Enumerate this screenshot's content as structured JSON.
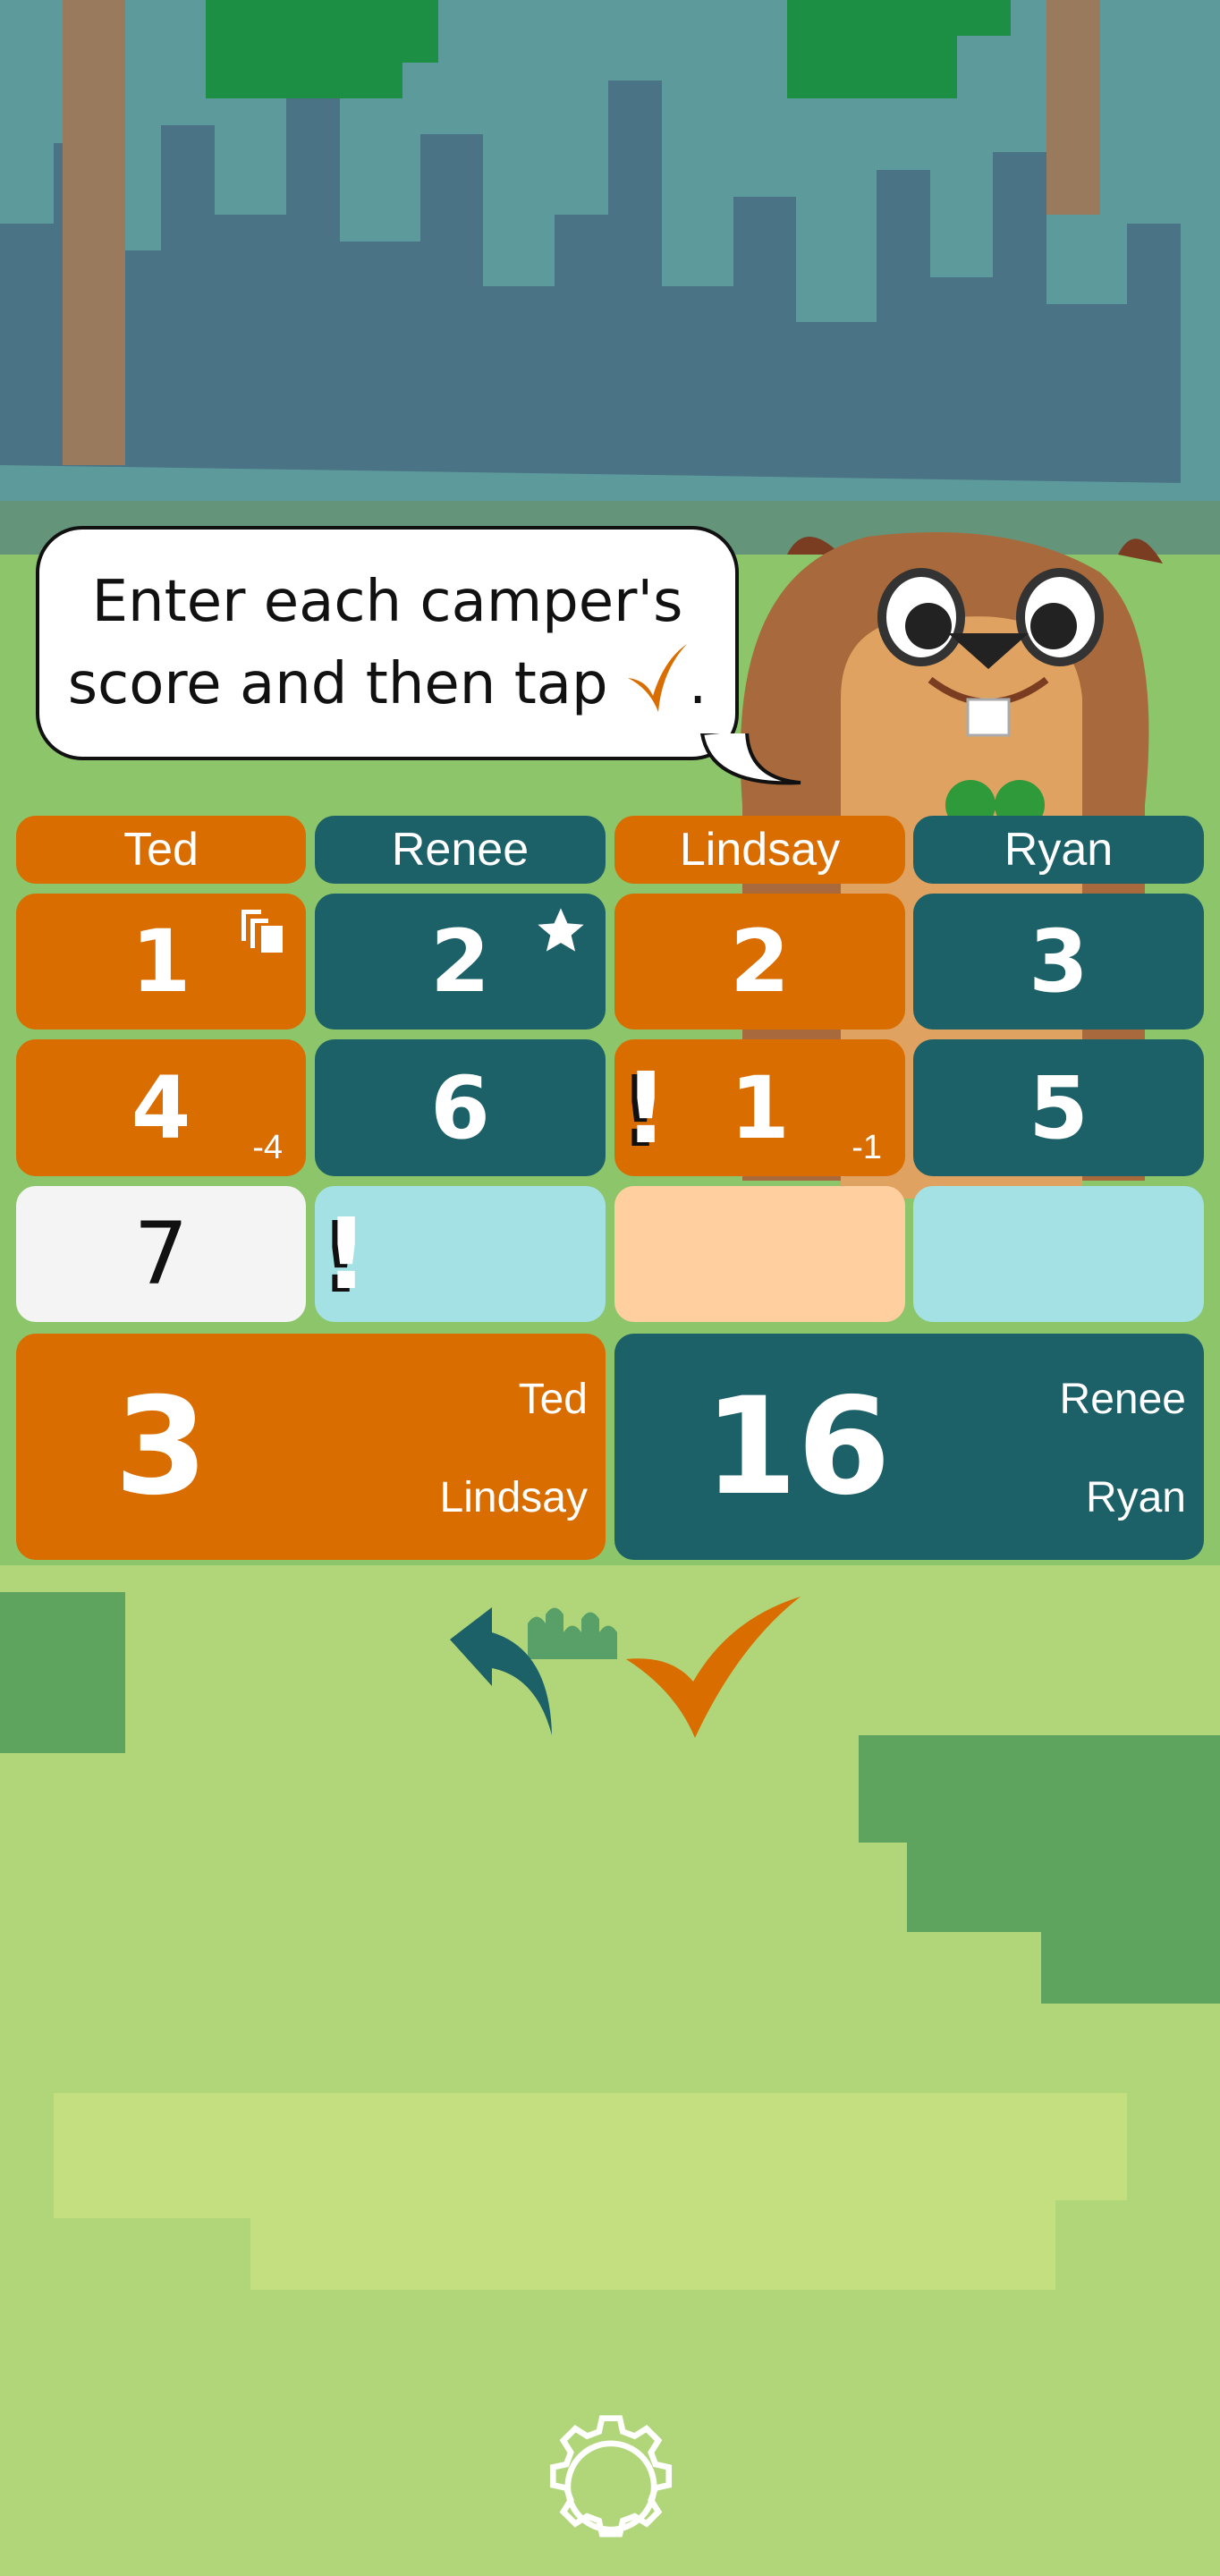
{
  "instruction": {
    "line1": "Enter each camper's",
    "line2": "score and then tap",
    "period": "."
  },
  "colors": {
    "orange": "#d96d00",
    "teal": "#1c6068",
    "light_teal": "#a4e1e4",
    "light_orange": "#ffcfa0",
    "input_bg": "#f4f4f4"
  },
  "players": [
    {
      "name": "Ted",
      "team": "orange",
      "rounds": [
        {
          "score": "1",
          "icon": "cards-icon"
        },
        {
          "score": "4",
          "penalty": "-4"
        }
      ],
      "current_input": "7"
    },
    {
      "name": "Renee",
      "team": "teal",
      "rounds": [
        {
          "score": "2",
          "icon": "star-icon"
        },
        {
          "score": "6"
        }
      ],
      "current_input": "",
      "input_alert": "!"
    },
    {
      "name": "Lindsay",
      "team": "orange",
      "rounds": [
        {
          "score": "2"
        },
        {
          "score": "1",
          "penalty": "-1",
          "alert": "!"
        }
      ],
      "current_input": ""
    },
    {
      "name": "Ryan",
      "team": "teal",
      "rounds": [
        {
          "score": "3"
        },
        {
          "score": "5"
        }
      ],
      "current_input": ""
    }
  ],
  "totals": [
    {
      "score": "3",
      "members": [
        "Ted",
        "Lindsay"
      ],
      "team": "orange"
    },
    {
      "score": "16",
      "members": [
        "Renee",
        "Ryan"
      ],
      "team": "teal"
    }
  ],
  "controls": {
    "undo_icon": "undo-arrow-icon",
    "confirm_icon": "checkmark-icon",
    "settings_icon": "gear-icon"
  }
}
